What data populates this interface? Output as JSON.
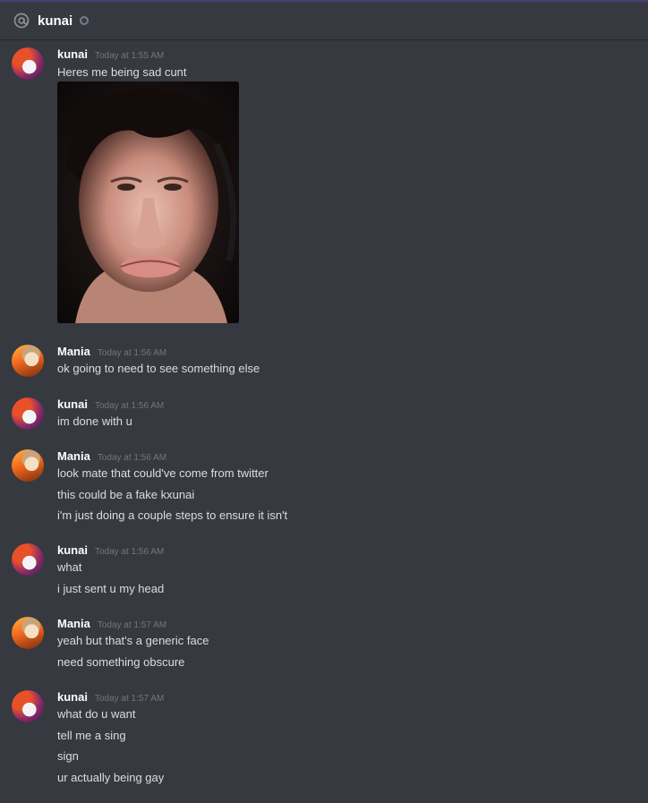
{
  "header": {
    "channel_name": "kunai",
    "icon": "at-icon",
    "status": "offline"
  },
  "colors": {
    "background": "#36393f",
    "username": "#ffffff",
    "text": "#dcddde",
    "timestamp": "#72767d"
  },
  "messages": [
    {
      "author": "kunai",
      "timestamp": "Today at 1:55 AM",
      "lines": [
        "Heres me being sad cunt"
      ],
      "attachment": "selfie-image"
    },
    {
      "author": "Mania",
      "timestamp": "Today at 1:56 AM",
      "lines": [
        "ok going to need to see something else"
      ]
    },
    {
      "author": "kunai",
      "timestamp": "Today at 1:56 AM",
      "lines": [
        "im done with u"
      ]
    },
    {
      "author": "Mania",
      "timestamp": "Today at 1:56 AM",
      "lines": [
        "look mate that could've come from twitter",
        "this could be a fake kxunai",
        "i'm just doing a couple steps to ensure it isn't"
      ]
    },
    {
      "author": "kunai",
      "timestamp": "Today at 1:56 AM",
      "lines": [
        "what",
        "i just sent u my head"
      ]
    },
    {
      "author": "Mania",
      "timestamp": "Today at 1:57 AM",
      "lines": [
        "yeah but that's a generic face",
        "need something obscure"
      ]
    },
    {
      "author": "kunai",
      "timestamp": "Today at 1:57 AM",
      "lines": [
        "what do u want",
        "tell me a sing",
        "sign",
        "ur actually being gay"
      ]
    }
  ]
}
